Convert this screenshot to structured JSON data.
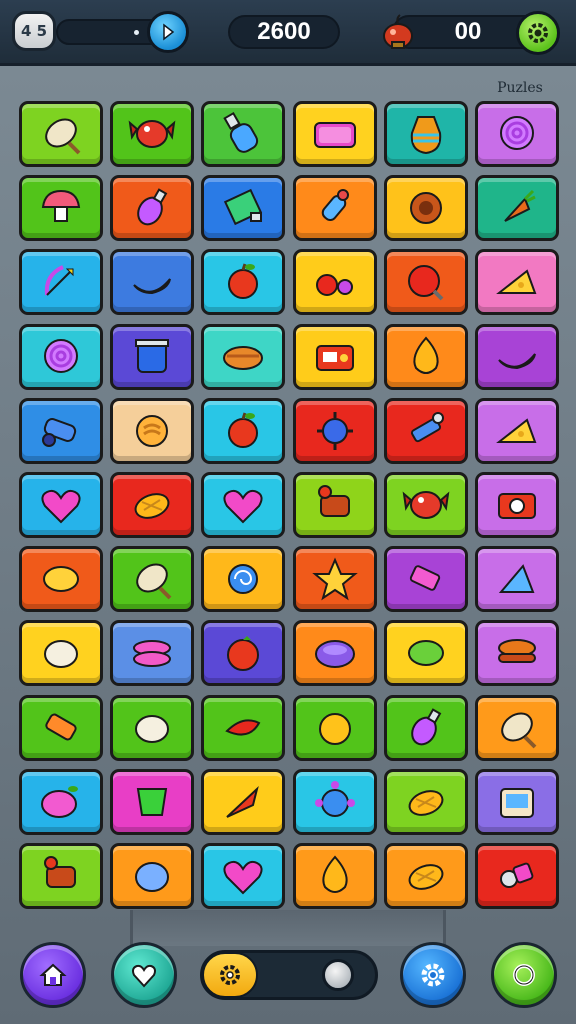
{
  "hud": {
    "level_label": "4 5",
    "score": "2600",
    "bonus": "00",
    "board_label": "Puzles",
    "icons": [
      "arrow-right-icon",
      "bomb-icon",
      "gear-icon"
    ]
  },
  "bottom_bar": {
    "buttons": [
      "home-icon",
      "heart-icon",
      "settings-icon",
      "search-icon"
    ],
    "toggle_state": "off"
  },
  "tiles": [
    {
      "bg": "#7ed321",
      "icon": "leaf-icon"
    },
    {
      "bg": "#52c41a",
      "icon": "candy-icon"
    },
    {
      "bg": "#4cc43a",
      "icon": "bottle-icon"
    },
    {
      "bg": "#ffd21f",
      "icon": "purse-icon"
    },
    {
      "bg": "#1fb5a8",
      "icon": "vase-icon"
    },
    {
      "bg": "#c86ee8",
      "icon": "lollipop-icon"
    },
    {
      "bg": "#52c41a",
      "icon": "mushroom-icon"
    },
    {
      "bg": "#f05a1a",
      "icon": "potion-icon"
    },
    {
      "bg": "#2a7be6",
      "icon": "gem-icon"
    },
    {
      "bg": "#ff8a1a",
      "icon": "rocket-icon"
    },
    {
      "bg": "#ffc21a",
      "icon": "cookie-icon"
    },
    {
      "bg": "#1fb58a",
      "icon": "carrot-icon"
    },
    {
      "bg": "#26b3ea",
      "icon": "bow-icon"
    },
    {
      "bg": "#3d7be0",
      "icon": "banana-icon"
    },
    {
      "bg": "#29c6e6",
      "icon": "apple-icon"
    },
    {
      "bg": "#ffcc1a",
      "icon": "cherry-icon"
    },
    {
      "bg": "#f05a1a",
      "icon": "ball-icon"
    },
    {
      "bg": "#f279c2",
      "icon": "cheese-icon"
    },
    {
      "bg": "#2ec8d8",
      "icon": "lollipop-icon"
    },
    {
      "bg": "#5b49d6",
      "icon": "jar-icon"
    },
    {
      "bg": "#3ed6c6",
      "icon": "pie-icon"
    },
    {
      "bg": "#ffcc1a",
      "icon": "radio-icon"
    },
    {
      "bg": "#ff8a1a",
      "icon": "drop-icon"
    },
    {
      "bg": "#a843d6",
      "icon": "banana-icon"
    },
    {
      "bg": "#2f8ee6",
      "icon": "cannon-icon"
    },
    {
      "bg": "#f5cf9a",
      "icon": "donut-icon"
    },
    {
      "bg": "#29c6e6",
      "icon": "apple-icon"
    },
    {
      "bg": "#e8281e",
      "icon": "spark-icon"
    },
    {
      "bg": "#e8281e",
      "icon": "wrench-icon"
    },
    {
      "bg": "#c86ee8",
      "icon": "cheese-icon"
    },
    {
      "bg": "#26b3ea",
      "icon": "heart-icon"
    },
    {
      "bg": "#e8281e",
      "icon": "corn-icon"
    },
    {
      "bg": "#29c6e6",
      "icon": "heart-icon"
    },
    {
      "bg": "#8fd41a",
      "icon": "dino-icon"
    },
    {
      "bg": "#7ed321",
      "icon": "candy-icon"
    },
    {
      "bg": "#c86ee8",
      "icon": "camera-icon"
    },
    {
      "bg": "#f05a1a",
      "icon": "lemon-icon"
    },
    {
      "bg": "#52c41a",
      "icon": "leaf-icon"
    },
    {
      "bg": "#ffb81a",
      "icon": "shell-icon"
    },
    {
      "bg": "#f05a1a",
      "icon": "star-icon"
    },
    {
      "bg": "#a843d6",
      "icon": "eraser-icon"
    },
    {
      "bg": "#c86ee8",
      "icon": "hat-icon"
    },
    {
      "bg": "#ffd21f",
      "icon": "egg-icon"
    },
    {
      "bg": "#5b8fe6",
      "icon": "macaron-icon"
    },
    {
      "bg": "#5b49d6",
      "icon": "tomato-icon"
    },
    {
      "bg": "#ff8a1a",
      "icon": "bowl-icon"
    },
    {
      "bg": "#ffd21f",
      "icon": "lime-icon"
    },
    {
      "bg": "#c86ee8",
      "icon": "burger-icon"
    },
    {
      "bg": "#52c41a",
      "icon": "candy-bar-icon"
    },
    {
      "bg": "#52c41a",
      "icon": "egg-icon"
    },
    {
      "bg": "#52c41a",
      "icon": "chili-icon"
    },
    {
      "bg": "#52c41a",
      "icon": "orange-icon"
    },
    {
      "bg": "#52c41a",
      "icon": "potion-icon"
    },
    {
      "bg": "#ff9a1a",
      "icon": "leaf-icon"
    },
    {
      "bg": "#26b3ea",
      "icon": "plum-icon"
    },
    {
      "bg": "#e83ec6",
      "icon": "cup-icon"
    },
    {
      "bg": "#ffcc1a",
      "icon": "arrow-icon"
    },
    {
      "bg": "#29c6e6",
      "icon": "turtle-icon"
    },
    {
      "bg": "#7ed321",
      "icon": "corn-icon"
    },
    {
      "bg": "#8a6ee6",
      "icon": "tablet-icon"
    },
    {
      "bg": "#7ed321",
      "icon": "dino-icon"
    },
    {
      "bg": "#ff9a1a",
      "icon": "blueberry-icon"
    },
    {
      "bg": "#29c6e6",
      "icon": "heart-icon"
    },
    {
      "bg": "#ff9a1a",
      "icon": "drop-icon"
    },
    {
      "bg": "#ff9a1a",
      "icon": "corn-icon"
    },
    {
      "bg": "#e8281e",
      "icon": "key-icon"
    }
  ]
}
